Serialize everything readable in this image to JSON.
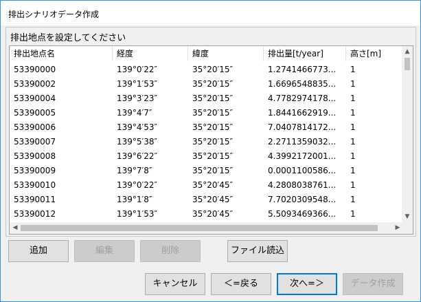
{
  "window": {
    "title": "排出シナリオデータ作成"
  },
  "group": {
    "label": "排出地点を設定してください"
  },
  "table": {
    "columns": [
      "排出地点名",
      "経度",
      "緯度",
      "排出量[t/year]",
      "高さ[m]"
    ],
    "rows": [
      [
        "53390000",
        "139°0′22″",
        "35°20′15″",
        "1.2741466773...",
        "1"
      ],
      [
        "53390002",
        "139°1′53″",
        "35°20′15″",
        "1.6696548835...",
        "1"
      ],
      [
        "53390004",
        "139°3′23″",
        "35°20′15″",
        "4.7782974178...",
        "1"
      ],
      [
        "53390005",
        "139°4′7″",
        "35°20′15″",
        "1.8441662919...",
        "1"
      ],
      [
        "53390006",
        "139°4′53″",
        "35°20′15″",
        "7.0407814172...",
        "1"
      ],
      [
        "53390007",
        "139°5′38″",
        "35°20′15″",
        "2.2711359032...",
        "1"
      ],
      [
        "53390008",
        "139°6′22″",
        "35°20′15″",
        "4.3992172001...",
        "1"
      ],
      [
        "53390009",
        "139°7′8″",
        "35°20′15″",
        "0.0001100586...",
        "1"
      ],
      [
        "53390010",
        "139°0′22″",
        "35°20′45″",
        "4.2808038761...",
        "1"
      ],
      [
        "53390011",
        "139°1′8″",
        "35°20′45″",
        "7.7020309548...",
        "1"
      ],
      [
        "53390012",
        "139°1′53″",
        "35°20′45″",
        "5.5093469366...",
        "1"
      ]
    ]
  },
  "buttons": {
    "add": "追加",
    "edit": "編集",
    "delete": "削除",
    "load_file": "ファイル読込",
    "cancel": "キャンセル",
    "back": "＜=戻る",
    "next": "次へ=＞",
    "create": "データ作成"
  },
  "icons": {
    "scroll_up": "up-arrow-icon",
    "scroll_down": "down-arrow-icon",
    "scroll_left": "left-arrow-icon",
    "scroll_right": "right-arrow-icon"
  }
}
